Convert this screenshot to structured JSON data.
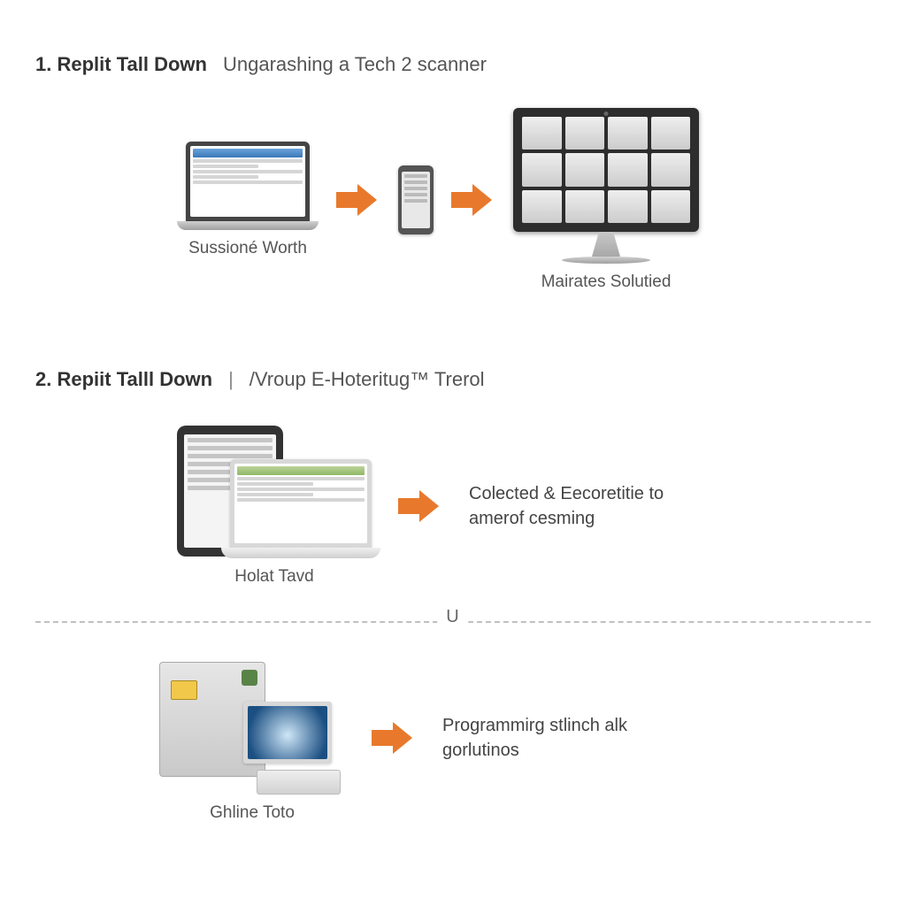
{
  "section1": {
    "prefix": "1.",
    "title": "Replit Tall Down",
    "sub": "Ungarashing a Tech 2 scanner",
    "laptop_caption": "Sussioné Worth",
    "monitor_caption": "Mairates Solutied"
  },
  "section2": {
    "prefix": "2.",
    "title": "Repiit Talll Down",
    "pipe": "|",
    "sub": "/Vroup E-Hoteritug™ Trerol",
    "combo_caption": "Holat Tavd",
    "desc": "Colected & Eecoretitie to amerof cesming"
  },
  "separator_label": "U",
  "section3": {
    "machine_caption": "Ghline Toto",
    "desc": "Programmirg stlinch alk gorlutinos"
  }
}
